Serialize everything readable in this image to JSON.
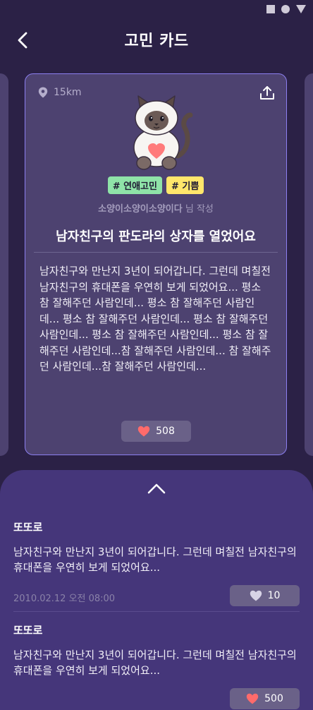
{
  "header": {
    "title": "고민 카드"
  },
  "card": {
    "distance": "15km",
    "tags": [
      "# 연애고민",
      "# 기쁨"
    ],
    "author": "소양이소양이소양이다",
    "author_suffix": "님 작성",
    "title": "남자친구의 판도라의 상자를 열었어요",
    "body": "남자친구와 만난지 3년이 되어갑니다. 그런데 며칠전 남자친구의 휴대폰을 우연히 보게 되었어요... 평소 참 잘해주던 사람인데... 평소 참 잘해주던 사람인데... 평소 참 잘해주던 사람인데... 평소 참 잘해주던 사람인데... 평소 참 잘해주던 사람인데... 평소 참 잘해주던 사람인데...참 잘해주던 사람인데... 참 잘해주던 사람인데...참 잘해주던 사람인데...",
    "likes": "508"
  },
  "comments": [
    {
      "author": "또또로",
      "text": "남자친구와 만난지 3년이 되어갑니다. 그런데 며칠전 남자친구의 휴대폰을 우연히 보게 되었어요...",
      "date": "2010.02.12 오전 08:00",
      "likes": "10"
    },
    {
      "author": "또또로",
      "text": "남자친구와 만난지 3년이 되어갑니다. 그런데 며칠전 남자친구의 휴대폰을 우연히 보게 되었어요...",
      "likes": "500"
    }
  ],
  "colors": {
    "background": "#2b2146",
    "card": "#4d4270",
    "card_border": "#8c7ff0",
    "tag_green": "#8fe3a8",
    "tag_yellow": "#ffe66b",
    "heart": "#ff6b6b",
    "panel": "#45367a"
  },
  "icons": {
    "back": "chevron-left-icon",
    "location": "location-pin-icon",
    "share": "share-icon",
    "heart": "heart-icon",
    "collapse": "chevron-up-icon"
  }
}
